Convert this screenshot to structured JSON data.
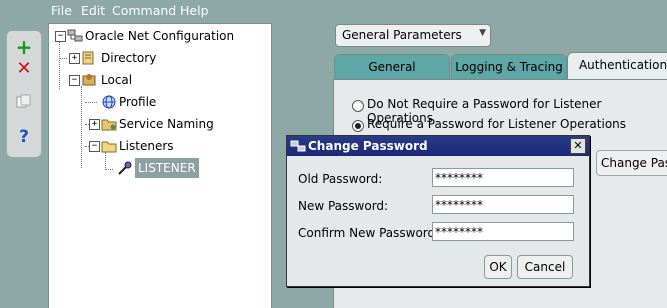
{
  "menu": {
    "file": "File",
    "edit": "Edit",
    "command": "Command",
    "help": "Help"
  },
  "toolbar": {
    "add_icon": "plus-icon",
    "remove_icon": "x-icon",
    "help_icon": "question-icon"
  },
  "tree": {
    "root": "Oracle Net Configuration",
    "directory": "Directory",
    "local": "Local",
    "profile": "Profile",
    "service_naming": "Service Naming",
    "listeners": "Listeners",
    "listener": "LISTENER"
  },
  "combo": {
    "value": "General Parameters"
  },
  "tabs": {
    "general": "General",
    "logging": "Logging & Tracing",
    "authentication": "Authentication"
  },
  "auth": {
    "option_no_password": "Do Not Require a Password for Listener Operations",
    "option_require_password": "Require a Password for Listener Operations",
    "change_password_button": "Change Pas"
  },
  "dialog": {
    "title": "Change Password",
    "old_label": "Old Password:",
    "new_label": "New Password:",
    "confirm_label": "Confirm New Password:",
    "old_value": "********",
    "new_value": "********",
    "confirm_value": "********",
    "ok": "OK",
    "cancel": "Cancel"
  }
}
